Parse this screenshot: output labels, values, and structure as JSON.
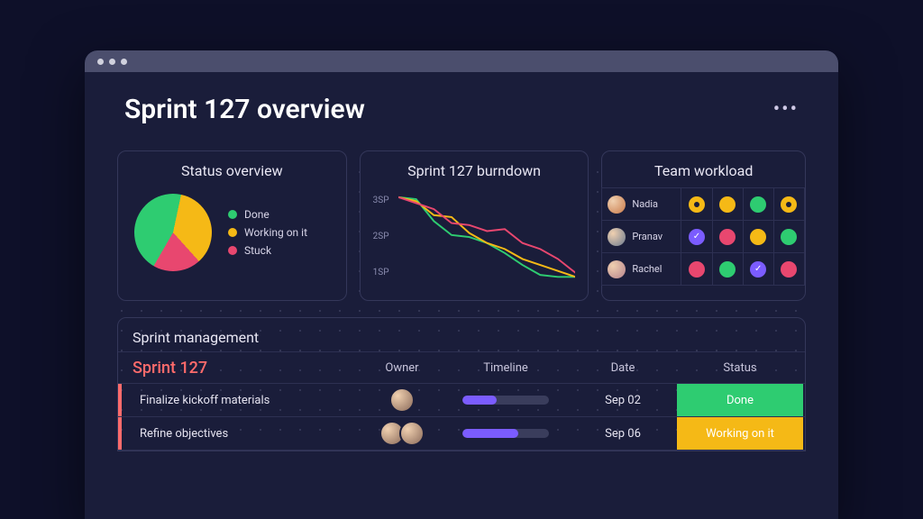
{
  "title": "Sprint 127 overview",
  "colors": {
    "done": "#2ecc71",
    "working": "#f5b916",
    "stuck": "#e8476f",
    "purple": "#7b5cff"
  },
  "chart_data": [
    {
      "type": "pie",
      "title": "Status overview",
      "series": [
        {
          "name": "Done",
          "value": 45,
          "color": "#2ecc71"
        },
        {
          "name": "Working on it",
          "value": 35,
          "color": "#f5b916"
        },
        {
          "name": "Stuck",
          "value": 20,
          "color": "#e8476f"
        }
      ]
    },
    {
      "type": "line",
      "title": "Sprint 127 burndown",
      "ylabel_ticks": [
        "3SP",
        "2SP",
        "1SP"
      ],
      "ylim": [
        1,
        3
      ],
      "x": [
        0,
        1,
        2,
        3,
        4,
        5,
        6,
        7,
        8,
        9,
        10
      ],
      "series": [
        {
          "name": "Done",
          "color": "#2ecc71",
          "values": [
            3.0,
            2.95,
            2.4,
            2.05,
            2.0,
            1.85,
            1.6,
            1.3,
            1.05,
            1.0,
            1.0
          ]
        },
        {
          "name": "Working on it",
          "color": "#f5b916",
          "values": [
            3.0,
            2.9,
            2.55,
            2.5,
            2.1,
            1.85,
            1.7,
            1.45,
            1.3,
            1.15,
            1.0
          ]
        },
        {
          "name": "Stuck",
          "color": "#e8476f",
          "values": [
            3.0,
            2.85,
            2.7,
            2.35,
            2.3,
            2.15,
            2.2,
            1.85,
            1.7,
            1.45,
            1.1
          ]
        }
      ]
    }
  ],
  "status_legend": [
    {
      "label": "Done",
      "color": "#2ecc71"
    },
    {
      "label": "Working on it",
      "color": "#f5b916"
    },
    {
      "label": "Stuck",
      "color": "#e8476f"
    }
  ],
  "workload": {
    "title": "Team workload",
    "members": [
      {
        "name": "Nadia",
        "cells": [
          {
            "color": "#f5b916",
            "style": "inner"
          },
          {
            "color": "#f5b916"
          },
          {
            "color": "#2ecc71"
          },
          {
            "color": "#f5b916",
            "style": "inner"
          }
        ]
      },
      {
        "name": "Pranav",
        "cells": [
          {
            "color": "#7b5cff",
            "style": "check"
          },
          {
            "color": "#e8476f"
          },
          {
            "color": "#f5b916"
          },
          {
            "color": "#2ecc71"
          }
        ]
      },
      {
        "name": "Rachel",
        "cells": [
          {
            "color": "#e8476f"
          },
          {
            "color": "#2ecc71"
          },
          {
            "color": "#7b5cff",
            "style": "check"
          },
          {
            "color": "#e8476f"
          }
        ]
      }
    ]
  },
  "mgmt": {
    "title": "Sprint management",
    "sprint_label": "Sprint 127",
    "columns": [
      "Owner",
      "Timeline",
      "Date",
      "Status"
    ],
    "rows": [
      {
        "title": "Finalize kickoff materials",
        "owners": 1,
        "timeline_pct": 40,
        "date": "Sep 02",
        "status": "Done",
        "status_color": "#2ecc71"
      },
      {
        "title": "Refine objectives",
        "owners": 2,
        "timeline_pct": 65,
        "date": "Sep 06",
        "status": "Working on it",
        "status_color": "#f5b916"
      }
    ]
  }
}
